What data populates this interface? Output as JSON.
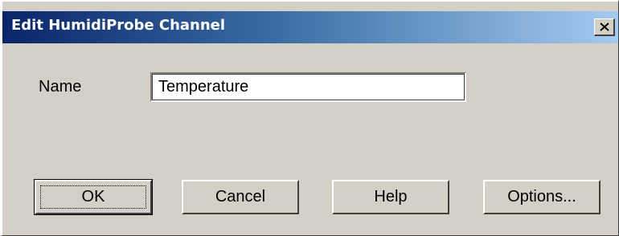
{
  "window": {
    "title": "Edit HumidiProbe Channel",
    "close_icon": "close-icon"
  },
  "form": {
    "name_label": "Name",
    "name_value": "Temperature"
  },
  "buttons": {
    "ok": "OK",
    "cancel": "Cancel",
    "help": "Help",
    "options": "Options..."
  },
  "colors": {
    "dialog_face": "#d4d0c8",
    "title_start": "#0a246a",
    "title_end": "#a6caf0"
  }
}
